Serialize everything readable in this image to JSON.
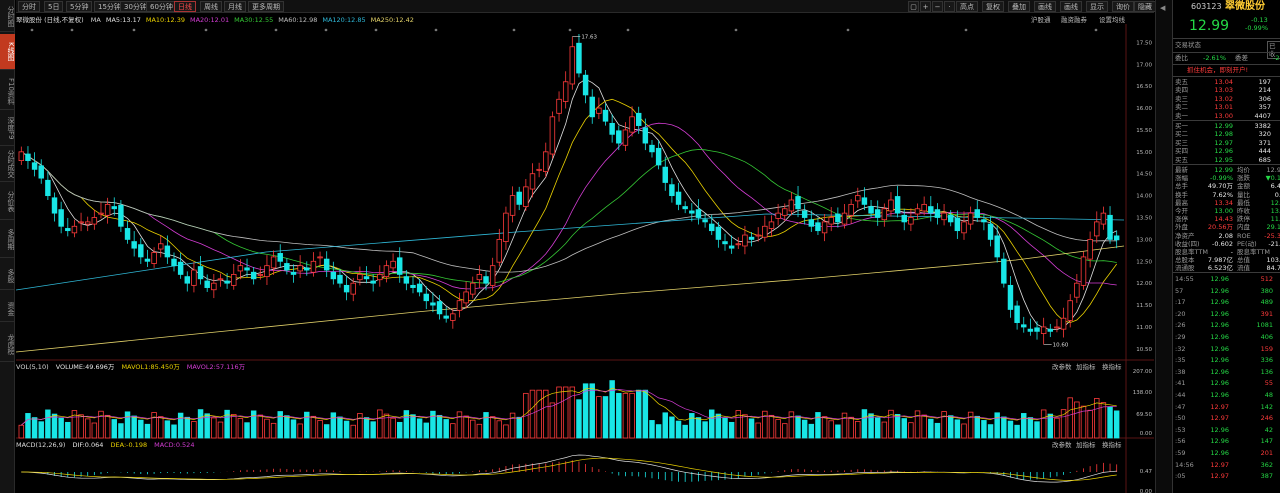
{
  "left_tabs": [
    "分时图",
    "K线图",
    "F10资料",
    "深度F9",
    "分时成交",
    "分价表",
    "多周期",
    "多股",
    "资金",
    "龙虎榜"
  ],
  "toolbar": {
    "periods": [
      "分时",
      "5日",
      "5分钟",
      "15分钟",
      "30分钟",
      "60分钟",
      "日线",
      "周线",
      "月线",
      "更多周期"
    ],
    "active_period": "日线",
    "right_buttons": [
      "高点",
      "复权",
      "叠加",
      "画线",
      "画线",
      "显示",
      "询价",
      "隐藏"
    ]
  },
  "stock": {
    "code": "603123",
    "name": "翠微股份",
    "name_plain": "翠微股份 (日线,不复权)"
  },
  "ma_legend": [
    {
      "label": "MA",
      "value": "",
      "color": "#cfcfcf"
    },
    {
      "label": "MA5:",
      "value": "13.17",
      "color": "#e0e0e0"
    },
    {
      "label": "MA10:",
      "value": "12.39",
      "color": "#e9d000"
    },
    {
      "label": "MA20:",
      "value": "12.01",
      "color": "#d33dd3"
    },
    {
      "label": "MA30:",
      "value": "12.55",
      "color": "#35c835"
    },
    {
      "label": "MA60:",
      "value": "12.98",
      "color": "#bfbfbf"
    },
    {
      "label": "MA120:",
      "value": "12.85",
      "color": "#2fb9d8"
    },
    {
      "label": "MA250:",
      "value": "12.42",
      "color": "#e4d36a"
    }
  ],
  "price_tabs": [
    "沪股通",
    "融资融券",
    "设置均线"
  ],
  "price_axis": [
    "17.50",
    "17.00",
    "16.50",
    "16.00",
    "15.50",
    "15.00",
    "14.50",
    "14.00",
    "13.50",
    "13.00",
    "12.50",
    "12.00",
    "11.50",
    "11.00",
    "10.50"
  ],
  "annotations": {
    "high": "17.63",
    "low": "10.60"
  },
  "vol_legend": {
    "name": "VOL(5,10)",
    "volume": "VOLUME:49.696万",
    "mavol1": "MAVOL1:85.450万",
    "mavol2": "MAVOL2:57.116万"
  },
  "vol_buttons": [
    "改参数",
    "加指标",
    "换指标"
  ],
  "vol_axis": [
    "207.00",
    "138.00",
    "69.50",
    "0.00"
  ],
  "macd_legend": {
    "name": "MACD(12,26,9)",
    "dif": "DIF:0.064",
    "dea": "DEA:-0.198",
    "macd": "MACD:0.524"
  },
  "macd_buttons": [
    "改参数",
    "加指标",
    "换指标"
  ],
  "macd_axis": [
    "0.47",
    "0.00"
  ],
  "quote": {
    "code": "603123",
    "name": "翠微股份",
    "price": "12.99",
    "change": "-0.13",
    "pct": "-0.99%",
    "status_label": "交易状态",
    "status_value": "已收",
    "ratio_label": "委比",
    "ratio_value": "-2.61%",
    "diff_label": "委差",
    "diff_value": "-2",
    "promo": "抓住机会，即刻开户!",
    "asks": [
      [
        "卖五",
        "13.04",
        "197"
      ],
      [
        "卖四",
        "13.03",
        "214"
      ],
      [
        "卖三",
        "13.02",
        "306"
      ],
      [
        "卖二",
        "13.01",
        "357"
      ],
      [
        "卖一",
        "13.00",
        "4407"
      ]
    ],
    "bids": [
      [
        "买一",
        "12.99",
        "3382"
      ],
      [
        "买二",
        "12.98",
        "320"
      ],
      [
        "买三",
        "12.97",
        "371"
      ],
      [
        "买四",
        "12.96",
        "444"
      ],
      [
        "买五",
        "12.95",
        "685"
      ]
    ],
    "stats": [
      [
        "最新",
        "12.99",
        "均价",
        "12.9"
      ],
      [
        "涨幅",
        "-0.99%",
        "涨跌",
        "▼0.1"
      ],
      [
        "总手",
        "49.70万",
        "金额",
        "6.4"
      ],
      [
        "换手",
        "7.62%",
        "量比",
        "0."
      ],
      [
        "最高",
        "13.34",
        "最低",
        "12."
      ],
      [
        "今开",
        "13.00",
        "昨收",
        "13."
      ],
      [
        "涨停",
        "14.43",
        "跌停",
        "11."
      ],
      [
        "外盘",
        "20.56万",
        "内盘",
        "29.1"
      ],
      [
        "净资产",
        "2.08",
        "ROE",
        "-25.3"
      ],
      [
        "收益(四)",
        "-0.602",
        "PE(动)",
        "-21."
      ],
      [
        "股息率TTM",
        "-",
        "股息率TTM",
        ""
      ],
      [
        "总股本",
        "7.987亿",
        "总值",
        "103."
      ],
      [
        "流通股",
        "6.523亿",
        "流值",
        "84.7"
      ]
    ],
    "ticks": [
      [
        "14:55",
        "12.96",
        "512"
      ],
      [
        "57",
        "12.96",
        "380"
      ],
      [
        ":17",
        "12.96",
        "489"
      ],
      [
        ":20",
        "12.96",
        "391"
      ],
      [
        ":26",
        "12.96",
        "1081"
      ],
      [
        ":29",
        "12.96",
        "406"
      ],
      [
        ":32",
        "12.96",
        "159"
      ],
      [
        ":35",
        "12.96",
        "336"
      ],
      [
        ":38",
        "12.96",
        "136"
      ],
      [
        ":41",
        "12.96",
        "55"
      ],
      [
        ":44",
        "12.96",
        "48"
      ],
      [
        ":47",
        "12.97",
        "142"
      ],
      [
        ":50",
        "12.97",
        "246"
      ],
      [
        ":53",
        "12.96",
        "42"
      ],
      [
        ":56",
        "12.96",
        "147"
      ],
      [
        ":59",
        "12.96",
        "201"
      ],
      [
        "14:56",
        "12.97",
        "362"
      ],
      [
        ":05",
        "12.97",
        "387"
      ]
    ]
  }
}
